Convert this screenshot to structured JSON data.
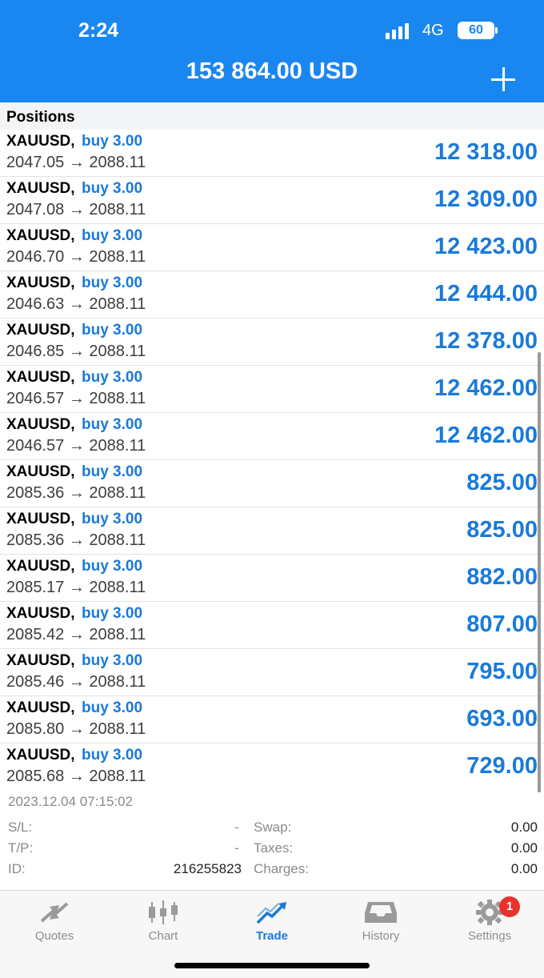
{
  "status_bar": {
    "time": "2:24",
    "network": "4G",
    "battery": "60"
  },
  "header": {
    "balance": "153 864.00 USD",
    "add_icon": "plus-icon"
  },
  "section": {
    "title": "Positions"
  },
  "positions": [
    {
      "symbol": "XAUUSD,",
      "side": "buy 3.00",
      "prices": "2047.05 → 2088.11",
      "profit": "12 318.00"
    },
    {
      "symbol": "XAUUSD,",
      "side": "buy 3.00",
      "prices": "2047.08 → 2088.11",
      "profit": "12 309.00"
    },
    {
      "symbol": "XAUUSD,",
      "side": "buy 3.00",
      "prices": "2046.70 → 2088.11",
      "profit": "12 423.00"
    },
    {
      "symbol": "XAUUSD,",
      "side": "buy 3.00",
      "prices": "2046.63 → 2088.11",
      "profit": "12 444.00"
    },
    {
      "symbol": "XAUUSD,",
      "side": "buy 3.00",
      "prices": "2046.85 → 2088.11",
      "profit": "12 378.00"
    },
    {
      "symbol": "XAUUSD,",
      "side": "buy 3.00",
      "prices": "2046.57 → 2088.11",
      "profit": "12 462.00"
    },
    {
      "symbol": "XAUUSD,",
      "side": "buy 3.00",
      "prices": "2046.57 → 2088.11",
      "profit": "12 462.00"
    },
    {
      "symbol": "XAUUSD,",
      "side": "buy 3.00",
      "prices": "2085.36 → 2088.11",
      "profit": "825.00"
    },
    {
      "symbol": "XAUUSD,",
      "side": "buy 3.00",
      "prices": "2085.36 → 2088.11",
      "profit": "825.00"
    },
    {
      "symbol": "XAUUSD,",
      "side": "buy 3.00",
      "prices": "2085.17 → 2088.11",
      "profit": "882.00"
    },
    {
      "symbol": "XAUUSD,",
      "side": "buy 3.00",
      "prices": "2085.42 → 2088.11",
      "profit": "807.00"
    },
    {
      "symbol": "XAUUSD,",
      "side": "buy 3.00",
      "prices": "2085.46 → 2088.11",
      "profit": "795.00"
    },
    {
      "symbol": "XAUUSD,",
      "side": "buy 3.00",
      "prices": "2085.80 → 2088.11",
      "profit": "693.00"
    },
    {
      "symbol": "XAUUSD,",
      "side": "buy 3.00",
      "prices": "2085.68 → 2088.11",
      "profit": "729.00"
    }
  ],
  "details": {
    "timestamp": "2023.12.04 07:15:02",
    "sl_label": "S/L:",
    "sl_value": "-",
    "tp_label": "T/P:",
    "tp_value": "-",
    "id_label": "ID:",
    "id_value": "216255823",
    "swap_label": "Swap:",
    "swap_value": "0.00",
    "taxes_label": "Taxes:",
    "taxes_value": "0.00",
    "charges_label": "Charges:",
    "charges_value": "0.00"
  },
  "tabs": [
    {
      "label": "Quotes",
      "icon": "quotes-arrows-icon"
    },
    {
      "label": "Chart",
      "icon": "candlestick-icon"
    },
    {
      "label": "Trade",
      "icon": "trade-trend-icon"
    },
    {
      "label": "History",
      "icon": "inbox-icon"
    },
    {
      "label": "Settings",
      "icon": "gear-icon"
    }
  ],
  "settings_badge": "1",
  "colors": {
    "header": "#1a87f0",
    "accent": "#1a7ad8",
    "badge": "#e9322d"
  }
}
